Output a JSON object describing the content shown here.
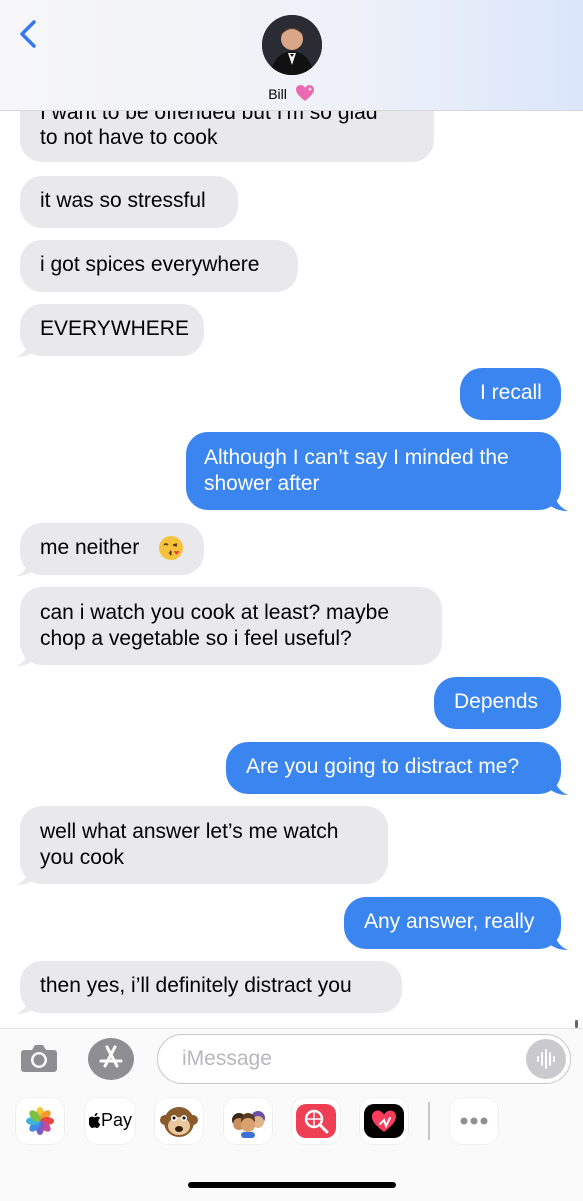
{
  "header": {
    "contact_name": "Bill"
  },
  "messages": [
    {
      "side": "in",
      "text": "I want to be offended but I'm so glad",
      "partial": true
    },
    {
      "side": "in",
      "text": "to not have to cook"
    },
    {
      "side": "in",
      "text": "it was so stressful"
    },
    {
      "side": "in",
      "text": "i got spices everywhere"
    },
    {
      "side": "in",
      "text": "EVERYWHERE"
    },
    {
      "side": "out",
      "text": "I recall"
    },
    {
      "side": "out",
      "text": "Although I can’t say I minded the"
    },
    {
      "side": "out",
      "text": "shower after"
    },
    {
      "side": "in",
      "text": "me neither"
    },
    {
      "side": "in",
      "text": "can i watch you cook at least? maybe"
    },
    {
      "side": "in",
      "text": "chop a vegetable so i feel useful?"
    },
    {
      "side": "out",
      "text": "Depends"
    },
    {
      "side": "out",
      "text": "Are you going to distract me?"
    },
    {
      "side": "in",
      "text": "well what answer let’s me watch"
    },
    {
      "side": "in",
      "text": "you cook"
    },
    {
      "side": "out",
      "text": "Any answer, really"
    },
    {
      "side": "in",
      "text": "then yes, i’ll definitely distract you"
    }
  ],
  "composer": {
    "placeholder": "iMessage"
  },
  "app_drawer": {
    "apple_pay_label": "Pay"
  },
  "colors": {
    "incoming_bubble": "#e9e9eb",
    "outgoing_bubble": "#3a85f0",
    "back_chevron": "#3478f6"
  }
}
